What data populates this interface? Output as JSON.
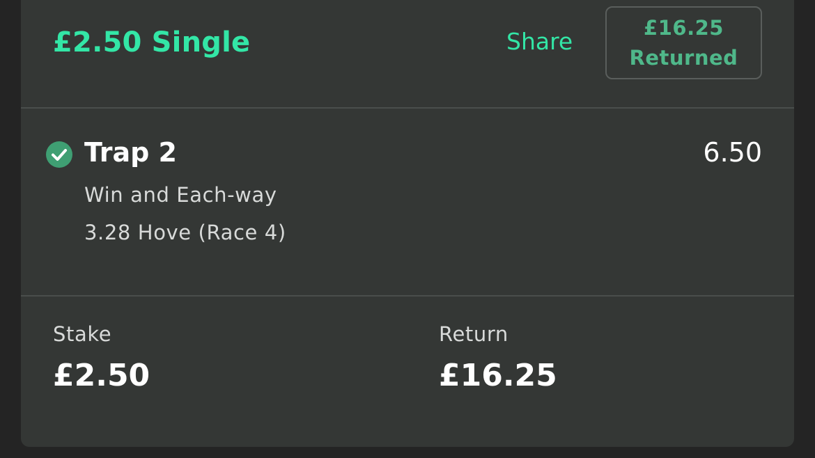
{
  "header": {
    "title": "£2.50 Single",
    "share_label": "Share",
    "returned_amount": "£16.25",
    "returned_label": "Returned"
  },
  "selection": {
    "name": "Trap 2",
    "odds": "6.50",
    "market": "Win and Each-way",
    "event": "3.28 Hove (Race 4)",
    "status_icon": "check-circle-icon"
  },
  "summary": {
    "stake_label": "Stake",
    "stake_value": "£2.50",
    "return_label": "Return",
    "return_value": "£16.25"
  },
  "colors": {
    "accent": "#33e6a6",
    "returned_text": "#4fb88a",
    "check_fill": "#3f9f73",
    "card_bg": "#343735",
    "page_bg": "#242424"
  }
}
